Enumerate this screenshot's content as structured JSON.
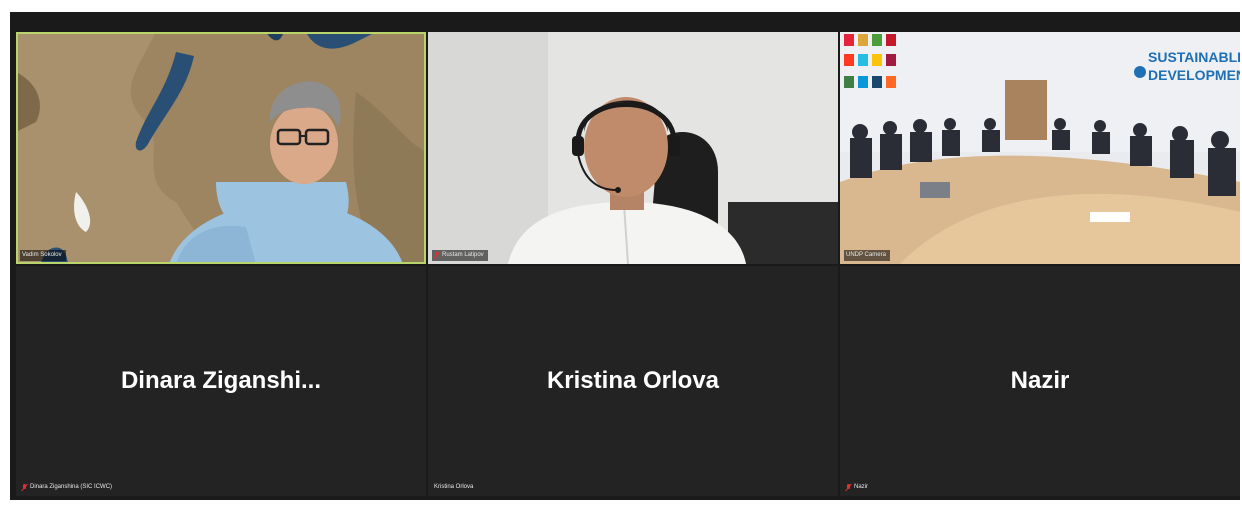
{
  "participants": {
    "video": [
      {
        "name": "Vadim Sokolov",
        "muted": false
      },
      {
        "name": "Rustam Latipov",
        "muted": true
      },
      {
        "name": "UNDP Camera",
        "muted": false
      }
    ],
    "avatar": [
      {
        "display_name": "Dinara  Ziganshi...",
        "name": "Dinara Ziganshina (SIC ICWC)",
        "muted": true
      },
      {
        "display_name": "Kristina Orlova",
        "name": "Kristina Orlova",
        "muted": false
      },
      {
        "display_name": "Nazir",
        "name": "Nazir",
        "muted": true
      }
    ]
  },
  "conference_room": {
    "banner_text_1": "SUSTAINABLE",
    "banner_text_2": "DEVELOPMENT"
  },
  "colors": {
    "active_speaker": "#b9d46a",
    "muted_mic": "#e0312f",
    "tile_bg": "#232323"
  }
}
